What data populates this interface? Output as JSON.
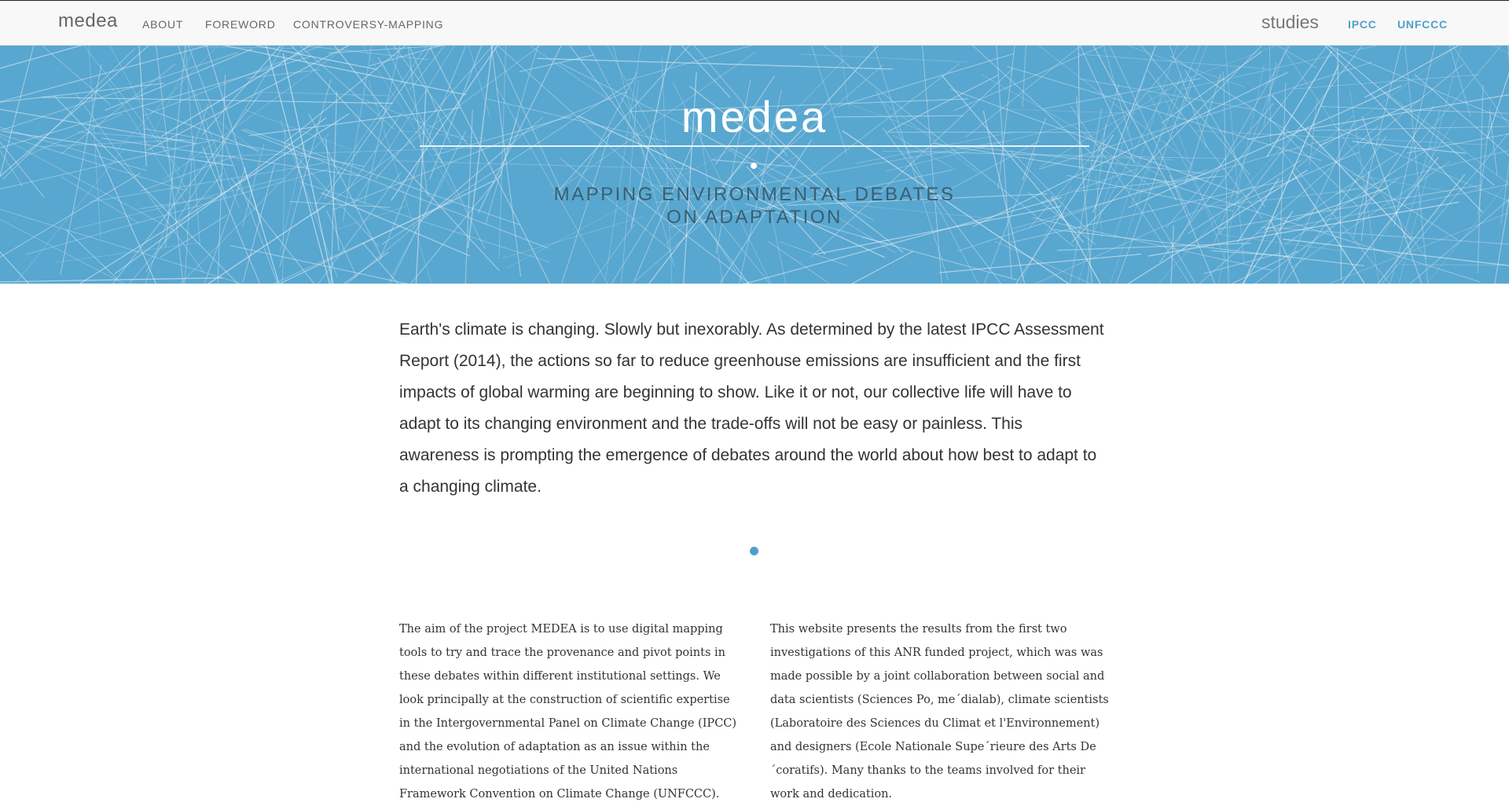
{
  "nav": {
    "brand": "medea",
    "links": [
      "ABOUT",
      "FOREWORD",
      "CONTROVERSY-MAPPING"
    ],
    "studies_label": "studies",
    "study_links": [
      "IPCC",
      "UNFCCC"
    ],
    "accent_color": "#4fa0cc"
  },
  "hero": {
    "title": "medea",
    "subtitle_line1": "MAPPING ENVIRONMENTAL DEBATES",
    "subtitle_line2": "ON ADAPTATION",
    "background_color": "#58a7d0"
  },
  "intro": {
    "lead": "Earth's climate is changing. Slowly but inexorably. As determined by the latest IPCC Assessment Report (2014), the actions so far to reduce greenhouse emissions are insufficient and the first impacts of global warming are beginning to show. Like it or not, our collective life will have to adapt to its changing environment and the trade-offs will not be easy or painless. This awareness is prompting the emergence of debates around the world about how best to adapt to a changing climate.",
    "col_left": "The aim of the project MEDEA is to use digital mapping tools to try and trace the provenance and pivot points in these debates within different institutional settings. We look principally at the construction of scientific expertise in the Intergovernmental Panel on Climate Change (IPCC) and the evolution of adaptation as an issue within the international negotiations of the United Nations Framework Convention on Climate Change (UNFCCC).",
    "col_right": "This website presents the results from the first two investigations of this ANR funded project, which was was made possible by a joint collaboration between social and data scientists (Sciences Po, me´dialab), climate scientists (Laboratoire des Sciences du Climat et l'Environnement) and designers (Ecole Nationale Supe´rieure des Arts De´coratifs). Many thanks to the teams involved for their work and dedication."
  }
}
